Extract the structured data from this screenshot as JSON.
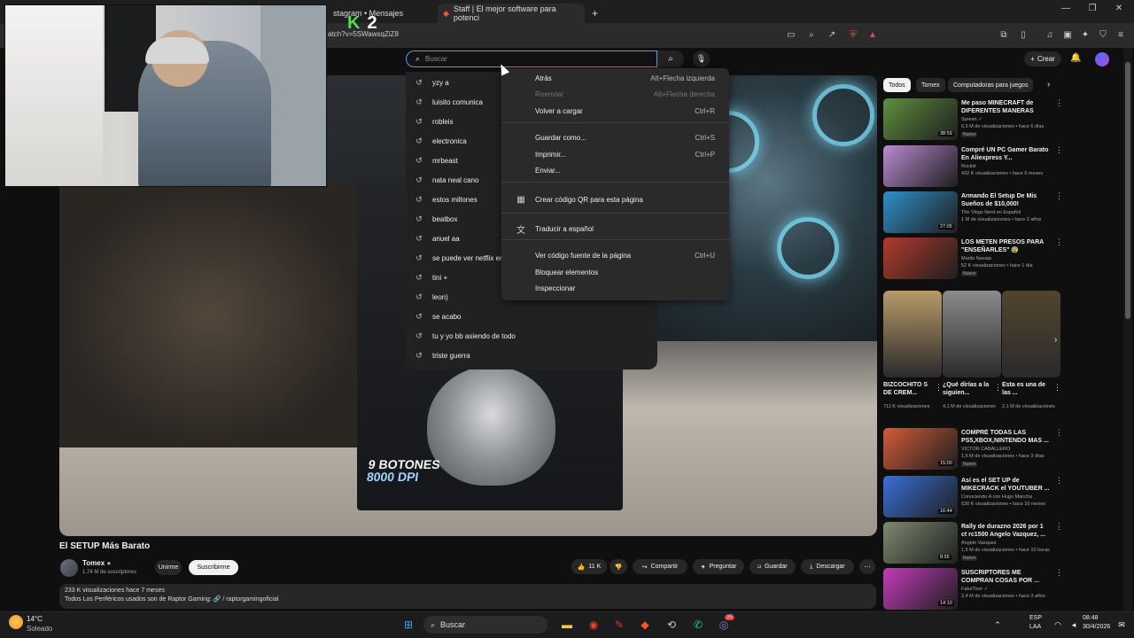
{
  "browser": {
    "tabs": [
      {
        "label": "stagram • Mensajes"
      },
      {
        "label": "Staff | El mejor software para potenci"
      }
    ],
    "new_tab": "+",
    "url_fragment": "atch?v=5SWawsqZiZ8"
  },
  "overlay": {
    "letter": "K",
    "number": "2"
  },
  "youtube": {
    "search_placeholder": "Buscar",
    "create_label": "Crear",
    "suggestions": [
      "yzy a",
      "luisito comunica",
      "robleis",
      "electronica",
      "mrbeast",
      "nata neal cano",
      "estos millones",
      "beatbox",
      "anuel aa",
      "se puede ver netflix en",
      "tini +",
      "leon)",
      "se acabo",
      "tu y yo bb asiendo de todo",
      "triste guerra"
    ]
  },
  "context_menu": {
    "items": [
      {
        "label": "Atrás",
        "shortcut": "Alt+Flecha izquierda",
        "disabled": false
      },
      {
        "label": "Reenviar",
        "shortcut": "Alt+Flecha derecha",
        "disabled": true
      },
      {
        "label": "Volver a cargar",
        "shortcut": "Ctrl+R",
        "disabled": false
      },
      {
        "label": "Guardar como...",
        "shortcut": "Ctrl+S",
        "disabled": false
      },
      {
        "label": "Imprimir...",
        "shortcut": "Ctrl+P",
        "disabled": false
      },
      {
        "label": "Enviar...",
        "shortcut": "",
        "disabled": false
      },
      {
        "label": "Crear código QR para esta página",
        "shortcut": "",
        "disabled": false,
        "icon": "qr-code-icon"
      },
      {
        "label": "Traducir a español",
        "shortcut": "",
        "disabled": false,
        "icon": "translate-icon"
      },
      {
        "label": "Ver código fuente de la página",
        "shortcut": "Ctrl+U",
        "disabled": false
      },
      {
        "label": "Bloquear elementos",
        "shortcut": "",
        "disabled": false
      },
      {
        "label": "Inspeccionar",
        "shortcut": "",
        "disabled": false
      }
    ]
  },
  "video": {
    "box_text_1": "9 BOTONES",
    "box_text_2": "8000 DPI",
    "title": "El SETUP Más Barato",
    "channel": "Tomex",
    "subscribers": "1,74 M de suscriptores",
    "join_label": "Unirme",
    "subscribe_label": "Suscribirme",
    "likes": "11 K",
    "share_label": "Compartir",
    "ask_label": "Preguntar",
    "save_label": "Guardar",
    "download_label": "Descargar",
    "views_date": "233 K visualizaciones  hace 7 meses",
    "description": "Todos Los Periféricos usados son de Raptor Gaming: 🔗 / raptorgamingoficial"
  },
  "sidebar": {
    "chips": [
      "Todos",
      "Tomex",
      "Computadoras para juegos"
    ],
    "recs_top": [
      {
        "title": "Me paso MINECRAFT de DIFERENTES MANERAS",
        "channel": "Spreen ✓",
        "meta": "6,5 M de visualizaciones • hace 6 días",
        "duration": "38:59",
        "badge": "Nuevo",
        "color": "#5e8f3f"
      },
      {
        "title": "Compré UN PC Gamer Barato En Aliexpress Y...",
        "channel": "Rockié",
        "meta": "432 K visualizaciones • hace 6 meses",
        "duration": "",
        "badge": "",
        "color": "#b98bd2"
      },
      {
        "title": "Armando El Setup De Mis Sueños de $10,000!",
        "channel": "The Vlogs Nerd en Español",
        "meta": "1 M de visualizaciones • hace 2 años",
        "duration": "27:05",
        "badge": "",
        "color": "#2f8fc9"
      },
      {
        "title": "LOS METEN PRESOS PARA \"ENSEÑARLES\" 😰 REACCIO...",
        "channel": "Marito Navaja",
        "meta": "52 K visualizaciones • hace 1 día",
        "duration": "",
        "badge": "Nuevo",
        "color": "#b33a2c"
      }
    ],
    "shorts": [
      {
        "title": "BIZCOCHITO S DE CREM...",
        "views": "711 K visualizaciones",
        "color": "#b89a6a"
      },
      {
        "title": "¿Qué dirías a la siguien...",
        "views": "4,1 M de visualizaciones",
        "color": "#8c8c8c"
      },
      {
        "title": "Esta es una de las ...",
        "views": "2,1 M de visualizaciones",
        "color": "#52452f"
      }
    ],
    "recs_bottom": [
      {
        "title": "COMPRÉ TODAS LAS PS5,XBOX,NINTENDO MAS ...",
        "channel": "VICTOR CABALLERO",
        "meta": "1,6 M de visualizaciones • hace 3 días",
        "duration": "15:00",
        "badge": "Nuevo",
        "color": "#d35a3a"
      },
      {
        "title": "Así es el SET UP de MIKECRACK el YOUTUBER ...",
        "channel": "Conociendo A con Hugo Mancha",
        "meta": "530 K visualizaciones • hace 10 meses",
        "duration": "16:44",
        "badge": "",
        "color": "#3a6fd8"
      },
      {
        "title": "Rally de durazno 2026 por 1 ct rc1500 Angelo Vazquez, ...",
        "channel": "Angelo Vazquez",
        "meta": "1,5 M de visualizaciones • hace 10 horas",
        "duration": "8:55",
        "badge": "Nuevo",
        "color": "#7d8a70"
      },
      {
        "title": "SUSCRIPTORES ME COMPRAN COSAS POR ...",
        "channel": "FabsTicer ✓",
        "meta": "2,4 M de visualizaciones • hace 3 años",
        "duration": "14:10",
        "badge": "",
        "color": "#c43bbb"
      }
    ]
  },
  "taskbar": {
    "weather_temp": "14°C",
    "weather_desc": "Soleado",
    "search_label": "Buscar",
    "lang_top": "ESP",
    "lang_bottom": "LAA",
    "time": "08:48",
    "date": "30/4/2026",
    "discord_badge": "25"
  }
}
